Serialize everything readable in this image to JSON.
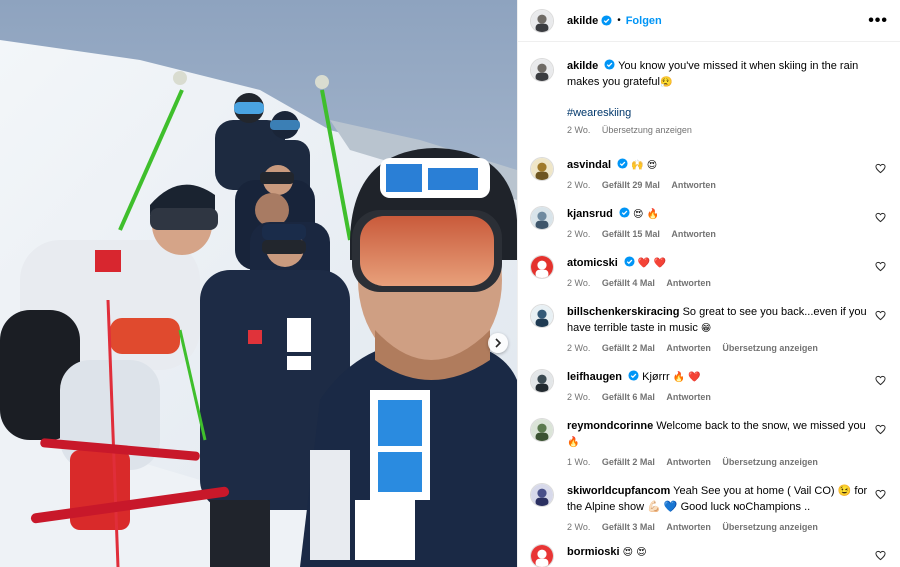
{
  "header": {
    "username": "akilde",
    "follow_label": "Folgen",
    "more_label": "•••"
  },
  "caption": {
    "username": "akilde",
    "text": "You know you've missed it when skiing in the rain makes you grateful",
    "emoji": "😮‍💨",
    "hashtag": "#weareskiing",
    "time": "2 Wo.",
    "translate_label": "Übersetzung anzeigen"
  },
  "comments": [
    {
      "username": "asvindal",
      "verified": true,
      "text": "",
      "emoji": "🙌 😍",
      "time": "2 Wo.",
      "likes": "Gefällt 29 Mal",
      "reply": "Antworten",
      "translate": ""
    },
    {
      "username": "kjansrud",
      "verified": true,
      "text": "",
      "emoji": "😍 🔥",
      "time": "2 Wo.",
      "likes": "Gefällt 15 Mal",
      "reply": "Antworten",
      "translate": ""
    },
    {
      "username": "atomicski",
      "verified": true,
      "text": "",
      "emoji": "❤️ ❤️",
      "time": "2 Wo.",
      "likes": "Gefällt 4 Mal",
      "reply": "Antworten",
      "translate": ""
    },
    {
      "username": "billschenkerskiracing",
      "verified": false,
      "text": "So great to see you back...even if you have terrible taste in music",
      "emoji": "😁",
      "time": "2 Wo.",
      "likes": "Gefällt 2 Mal",
      "reply": "Antworten",
      "translate": "Übersetzung anzeigen"
    },
    {
      "username": "leifhaugen",
      "verified": true,
      "text": "Kjørrr",
      "emoji": "🔥 ❤️",
      "time": "2 Wo.",
      "likes": "Gefällt 6 Mal",
      "reply": "Antworten",
      "translate": ""
    },
    {
      "username": "reymondcorinne",
      "verified": false,
      "text": "Welcome back to the snow, we missed you",
      "emoji": "🔥",
      "time": "1 Wo.",
      "likes": "Gefällt 2 Mal",
      "reply": "Antworten",
      "translate": "Übersetzung anzeigen"
    },
    {
      "username": "skiworldcupfancom",
      "verified": false,
      "text": "Yeah See you at home ( Vail CO) 😉  for the Alpine show 💪🏻 💙  Good luck ɴᴏChampions ..",
      "emoji": "",
      "time": "2 Wo.",
      "likes": "Gefällt 3 Mal",
      "reply": "Antworten",
      "translate": "Übersetzung anzeigen"
    },
    {
      "username": "bormioski",
      "verified": false,
      "text": "",
      "emoji": "😍 😍",
      "time": "",
      "likes": "",
      "reply": "",
      "translate": ""
    }
  ],
  "colors": {
    "accent": "#0095f6",
    "verified": "#0095f6",
    "meta": "#737373",
    "hashtag": "#00376b"
  },
  "icons": {
    "verified": "verified-badge-icon",
    "heart": "heart-outline-icon",
    "next": "chevron-right-icon",
    "more": "more-horizontal-icon"
  }
}
